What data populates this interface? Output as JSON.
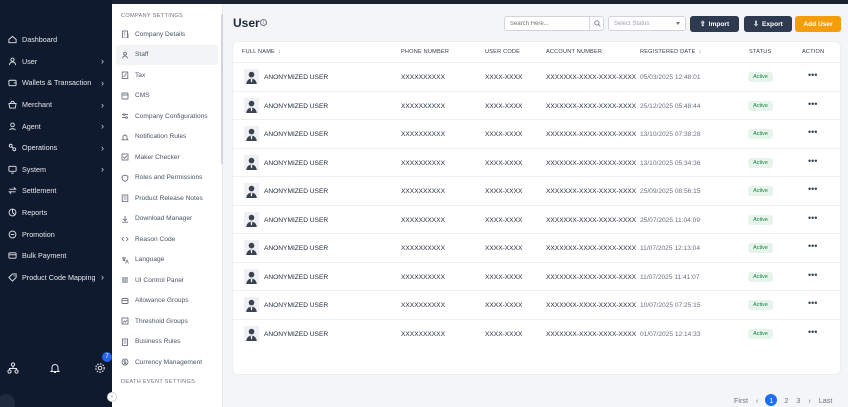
{
  "nav": {
    "items": [
      {
        "label": "Dashboard",
        "icon": "dashboard-icon",
        "has_children": false
      },
      {
        "label": "User",
        "icon": "user-icon",
        "has_children": true
      },
      {
        "label": "Wallets & Transaction",
        "icon": "wallet-icon",
        "has_children": true
      },
      {
        "label": "Merchant",
        "icon": "merchant-icon",
        "has_children": true
      },
      {
        "label": "Agent",
        "icon": "agent-icon",
        "has_children": true
      },
      {
        "label": "Operations",
        "icon": "operations-icon",
        "has_children": true
      },
      {
        "label": "System",
        "icon": "system-icon",
        "has_children": true
      },
      {
        "label": "Settlement",
        "icon": "settlement-icon",
        "has_children": false
      },
      {
        "label": "Reports",
        "icon": "reports-icon",
        "has_children": false
      },
      {
        "label": "Promotion",
        "icon": "promotion-icon",
        "has_children": false
      },
      {
        "label": "Bulk Payment",
        "icon": "bulk-payment-icon",
        "has_children": false
      },
      {
        "label": "Product Code Mapping",
        "icon": "product-code-icon",
        "has_children": true
      }
    ],
    "notification_count": "7"
  },
  "settings": {
    "heading": "COMPANY SETTINGS",
    "items": [
      {
        "label": "Company Details",
        "icon": "building-icon",
        "active": false
      },
      {
        "label": "Staff",
        "icon": "staff-icon",
        "active": true
      },
      {
        "label": "Tax",
        "icon": "tax-icon",
        "active": false
      },
      {
        "label": "CMS",
        "icon": "cms-icon",
        "active": false
      },
      {
        "label": "Company Configurations",
        "icon": "config-icon",
        "active": false
      },
      {
        "label": "Notification Rules",
        "icon": "notification-rules-icon",
        "active": false
      },
      {
        "label": "Maker Checker",
        "icon": "maker-checker-icon",
        "active": false
      },
      {
        "label": "Roles and Permissions",
        "icon": "roles-icon",
        "active": false
      },
      {
        "label": "Product Release Notes",
        "icon": "release-notes-icon",
        "active": false
      },
      {
        "label": "Download Manager",
        "icon": "download-icon",
        "active": false
      },
      {
        "label": "Reason Code",
        "icon": "reason-code-icon",
        "active": false
      },
      {
        "label": "Language",
        "icon": "language-icon",
        "active": false
      },
      {
        "label": "UI Control Panel",
        "icon": "ui-control-icon",
        "active": false
      },
      {
        "label": "Allowance Groups",
        "icon": "allowance-icon",
        "active": false
      },
      {
        "label": "Threshold Groups",
        "icon": "threshold-icon",
        "active": false
      },
      {
        "label": "Business Rules",
        "icon": "business-rules-icon",
        "active": false
      },
      {
        "label": "Currency Management",
        "icon": "currency-icon",
        "active": false
      }
    ],
    "footer_heading": "DEATH EVENT SETTINGS"
  },
  "header": {
    "title": "User",
    "search_placeholder": "Search Here...",
    "status_placeholder": "Select Status",
    "import_label": "Import",
    "export_label": "Export",
    "add_label": "Add User"
  },
  "table": {
    "columns": {
      "full_name": "FULL NAME",
      "phone": "PHONE NUMBER",
      "user_code": "USER CODE",
      "account": "ACCOUNT NUMBER",
      "registered": "REGISTERED DATE",
      "status": "STATUS",
      "action": "ACTION"
    },
    "rows": [
      {
        "name": "ANONYMIZED USER",
        "phone": "XXXXXXXXXX",
        "code": "XXXX-XXXX",
        "account": "XXXXXXX-XXXX-XXXX-XXXX",
        "date": "05/03/2025 12:48:01",
        "status": "Active"
      },
      {
        "name": "ANONYMIZED USER",
        "phone": "XXXXXXXXXX",
        "code": "XXXX-XXXX",
        "account": "XXXXXXX-XXXX-XXXX-XXXX",
        "date": "25/12/2025 05:48:44",
        "status": "Active"
      },
      {
        "name": "ANONYMIZED USER",
        "phone": "XXXXXXXXXX",
        "code": "XXXX-XXXX",
        "account": "XXXXXXX-XXXX-XXXX-XXXX",
        "date": "13/10/2025 07:38:28",
        "status": "Active"
      },
      {
        "name": "ANONYMIZED USER",
        "phone": "XXXXXXXXXX",
        "code": "XXXX-XXXX",
        "account": "XXXXXXX-XXXX-XXXX-XXXX",
        "date": "13/10/2025 05:34:36",
        "status": "Active"
      },
      {
        "name": "ANONYMIZED USER",
        "phone": "XXXXXXXXXX",
        "code": "XXXX-XXXX",
        "account": "XXXXXXX-XXXX-XXXX-XXXX",
        "date": "25/09/2025 08:56:15",
        "status": "Active"
      },
      {
        "name": "ANONYMIZED USER",
        "phone": "XXXXXXXXXX",
        "code": "XXXX-XXXX",
        "account": "XXXXXXX-XXXX-XXXX-XXXX",
        "date": "25/07/2025 11:04:09",
        "status": "Active"
      },
      {
        "name": "ANONYMIZED USER",
        "phone": "XXXXXXXXXX",
        "code": "XXXX-XXXX",
        "account": "XXXXXXX-XXXX-XXXX-XXXX",
        "date": "11/07/2025 12:13:04",
        "status": "Active"
      },
      {
        "name": "ANONYMIZED USER",
        "phone": "XXXXXXXXXX",
        "code": "XXXX-XXXX",
        "account": "XXXXXXX-XXXX-XXXX-XXXX",
        "date": "11/07/2025 11:41:07",
        "status": "Active"
      },
      {
        "name": "ANONYMIZED USER",
        "phone": "XXXXXXXXXX",
        "code": "XXXX-XXXX",
        "account": "XXXXXXX-XXXX-XXXX-XXXX",
        "date": "10/07/2025 07:25:15",
        "status": "Active"
      },
      {
        "name": "ANONYMIZED USER",
        "phone": "XXXXXXXXXX",
        "code": "XXXX-XXXX",
        "account": "XXXXXXX-XXXX-XXXX-XXXX",
        "date": "01/07/2025 12:14:33",
        "status": "Active"
      }
    ],
    "action_glyph": "•••"
  },
  "pagination": {
    "first": "First",
    "prev": "‹",
    "pages": [
      "1",
      "2",
      "3"
    ],
    "current": "1",
    "next": "›",
    "last": "Last"
  },
  "colors": {
    "nav_bg": "#0f1a2e",
    "primary": "#1d6ff2",
    "accent": "#f59e0b",
    "dark_button": "#2d3a4f",
    "active_badge_bg": "#e6f4ec",
    "active_badge_text": "#15803d"
  }
}
